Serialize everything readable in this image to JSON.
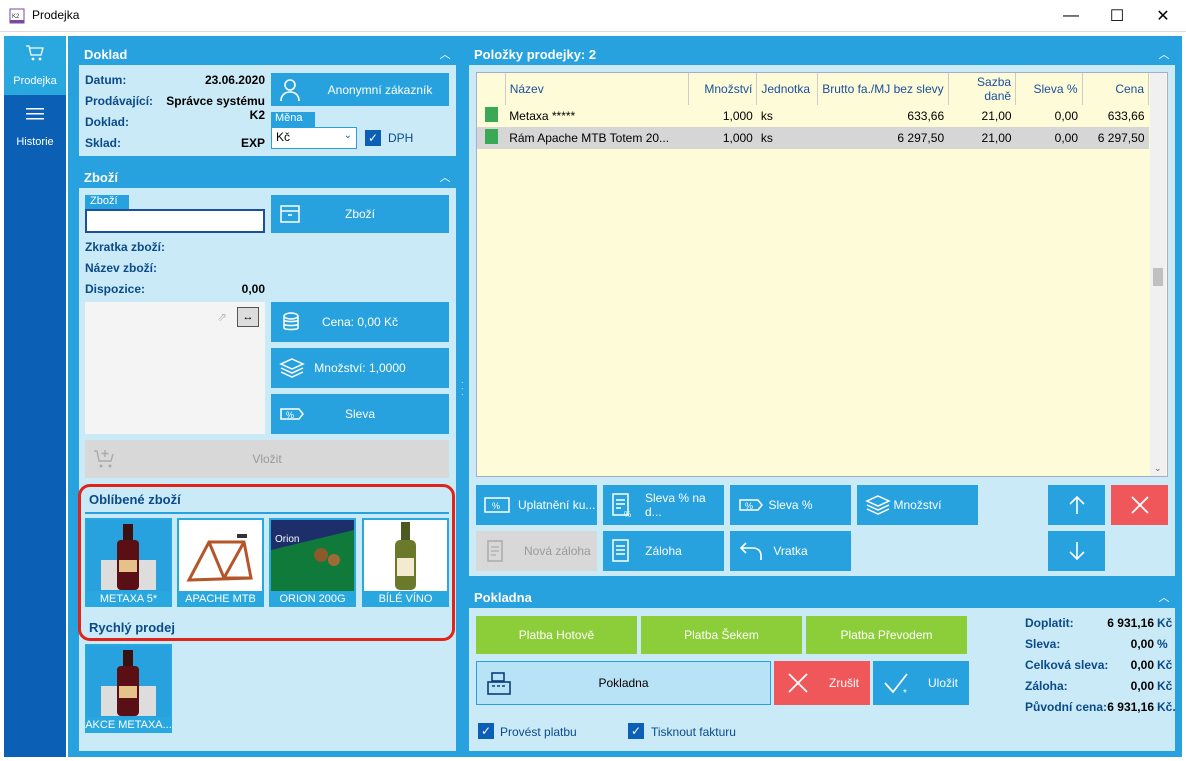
{
  "window": {
    "title": "Prodejka"
  },
  "nav": [
    {
      "label": "Prodejka",
      "icon": "cart-icon"
    },
    {
      "label": "Historie",
      "icon": "menu-icon"
    }
  ],
  "doklad": {
    "title": "Doklad",
    "datum_label": "Datum:",
    "datum_value": "23.06.2020",
    "prodavajici_label": "Prodávající:",
    "prodavajici_value": "Správce systému K2",
    "doklad_label": "Doklad:",
    "sklad_label": "Sklad:",
    "sklad_value": "EXP",
    "customer_button": "Anonymní zákazník",
    "mena_label": "Měna",
    "mena_value": "Kč",
    "dph_label": "DPH"
  },
  "zbozi": {
    "title": "Zboží",
    "input_label": "Zboží",
    "input_value": "",
    "button": "Zboží",
    "zkratka_label": "Zkratka zboží:",
    "nazev_label": "Název zboží:",
    "dispozice_label": "Dispozice:",
    "dispozice_value": "0,00",
    "cena_button": "Cena: 0,00 Kč",
    "mnozstvi_button": "Množství: 1,0000",
    "sleva_button": "Sleva",
    "vlozit_button": "Vložit"
  },
  "oblibene": {
    "title": "Oblíbené zboží",
    "tiles": [
      "METAXA 5*",
      "APACHE MTB",
      "ORION 200G",
      "BÍLÉ VÍNO"
    ]
  },
  "rychly": {
    "title": "Rychlý prodej",
    "tiles": [
      "AKCE METAXA..."
    ]
  },
  "polozky": {
    "title": "Položky prodejky: 2",
    "columns": [
      "Název",
      "Množství",
      "Jednotka",
      "Brutto fa./MJ bez slevy",
      "Sazba daně",
      "Sleva %",
      "Cena"
    ],
    "rows": [
      [
        "Metaxa *****",
        "1,000",
        "ks",
        "633,66",
        "21,00",
        "0,00",
        "633,66"
      ],
      [
        "Rám Apache MTB Totem 20...",
        "1,000",
        "ks",
        "6 297,50",
        "21,00",
        "0,00",
        "6 297,50"
      ]
    ]
  },
  "actions": {
    "uplatneni": "Uplatnění ku...",
    "sleva_na_d": "Sleva % na d...",
    "sleva_pct": "Sleva %",
    "mnozstvi": "Množství",
    "nova_zaloha": "Nová záloha",
    "zaloha": "Záloha",
    "vratka": "Vratka"
  },
  "pokladna": {
    "title": "Pokladna",
    "platba_hotove": "Platba Hotově",
    "platba_sekem": "Platba Šekem",
    "platba_prevodem": "Platba Převodem",
    "pokladna_button": "Pokladna",
    "zrusit": "Zrušit",
    "ulozit": "Uložit",
    "provest_platbu": "Provést platbu",
    "tisknout_fakturu": "Tisknout fakturu",
    "summary": [
      {
        "label": "Doplatit:",
        "value": "6 931,16",
        "unit": "Kč"
      },
      {
        "label": "Sleva:",
        "value": "0,00",
        "unit": "%"
      },
      {
        "label": "Celková sleva:",
        "value": "0,00",
        "unit": "Kč"
      },
      {
        "label": "Záloha:",
        "value": "0,00",
        "unit": "Kč"
      },
      {
        "label": "Původní cena:",
        "value": "6 931,16",
        "unit": "Kč."
      }
    ]
  },
  "colors": {
    "accent": "#27a2df",
    "nav": "#0b5fb5",
    "panel": "#cbeaf8",
    "green": "#8ccd3a",
    "red": "#f0575b",
    "highlight": "#e2231a"
  }
}
